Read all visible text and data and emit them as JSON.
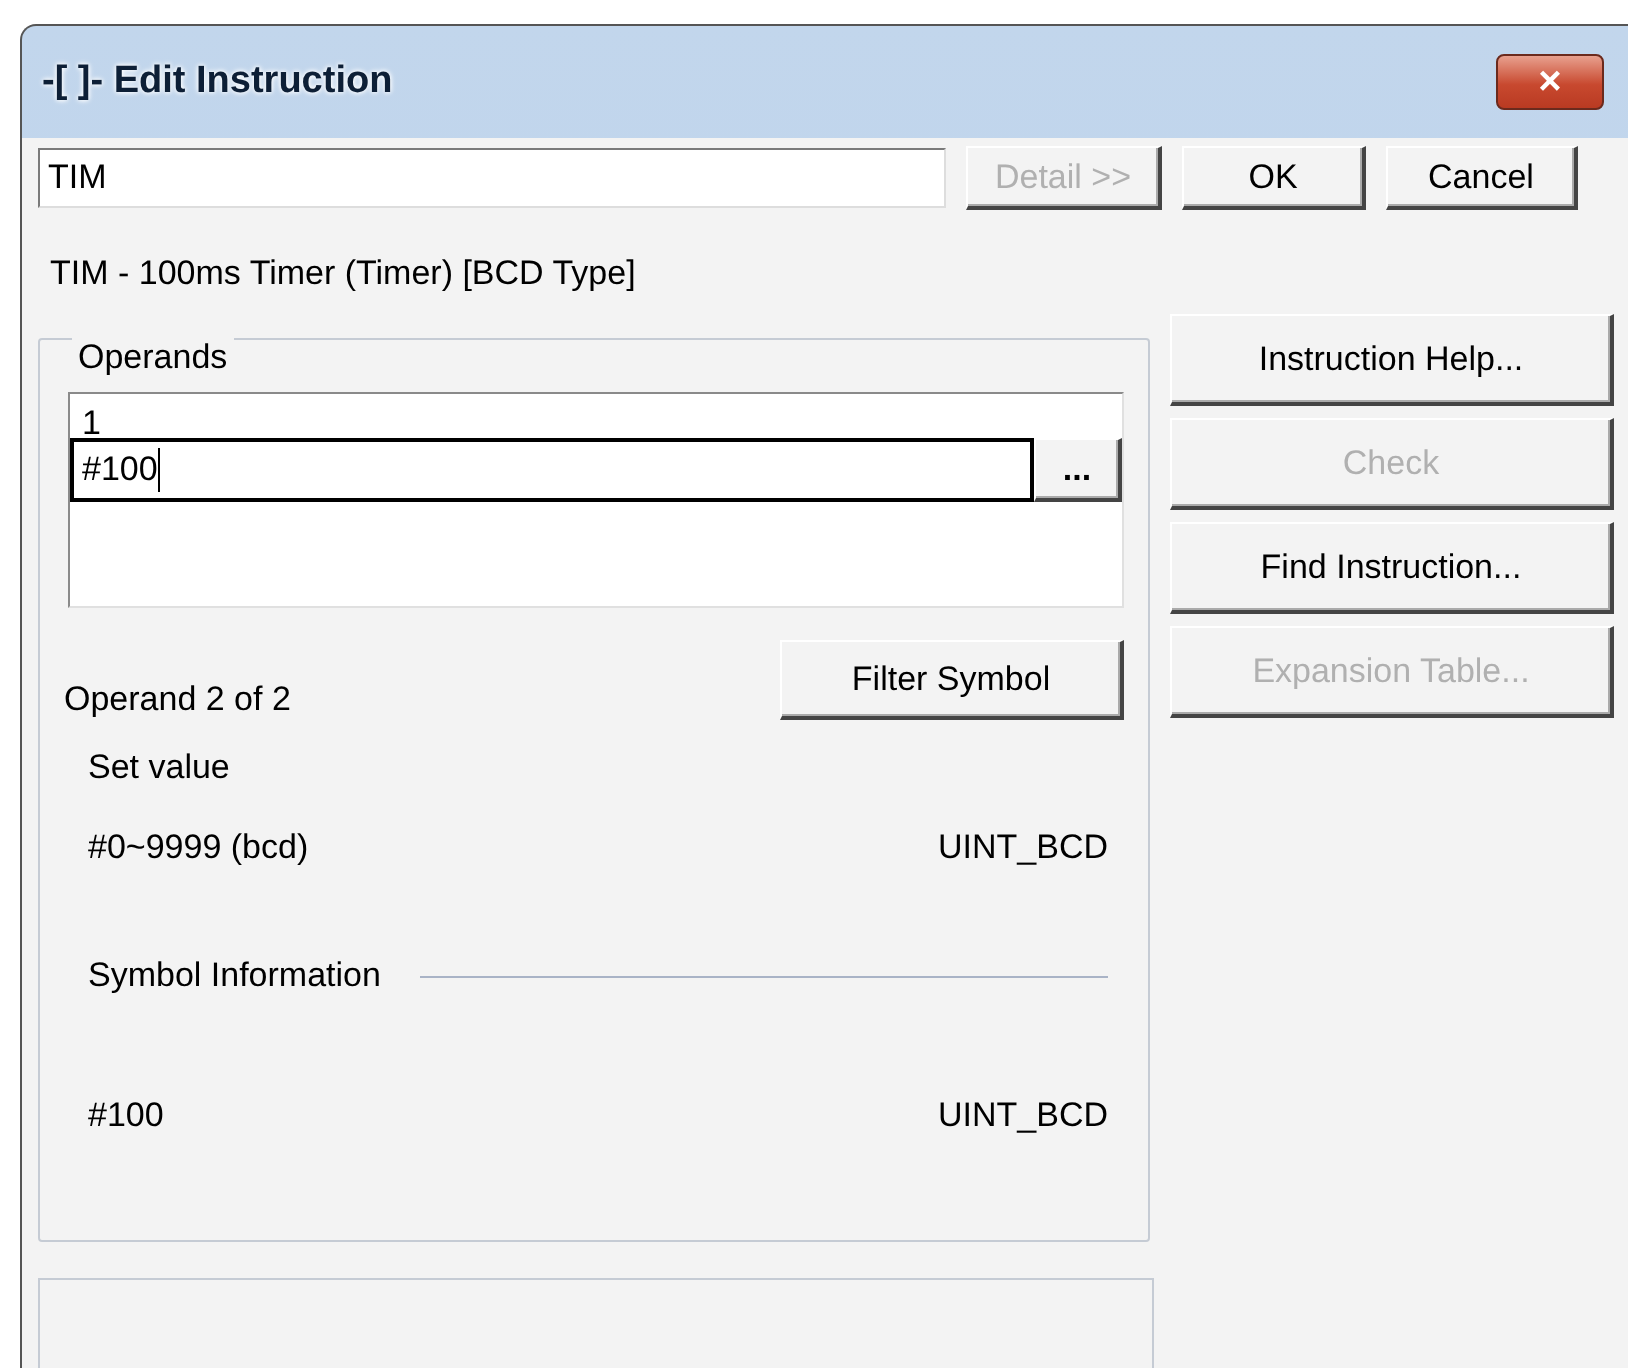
{
  "window": {
    "title": "-[ ]- Edit Instruction",
    "close": "×"
  },
  "instruction_field": {
    "value": "TIM"
  },
  "top_buttons": [
    {
      "label": "Detail >>",
      "disabled": true
    },
    {
      "label": "OK",
      "disabled": false
    },
    {
      "label": "Cancel",
      "disabled": false
    }
  ],
  "description": "TIM - 100ms Timer (Timer) [BCD Type]",
  "operands": {
    "title": "Operands",
    "rows": [
      {
        "value": "1",
        "kind": "text"
      },
      {
        "value": "#100",
        "kind": "editing",
        "browse": "..."
      }
    ],
    "position": "Operand 2 of 2",
    "filter_button": "Filter Symbol",
    "set_value_label": "Set value",
    "set_value_range": "#0~9999 (bcd)",
    "set_value_type": "UINT_BCD",
    "symbol_info_label": "Symbol Information",
    "symbol_value": "#100",
    "symbol_type": "UINT_BCD"
  },
  "side_buttons": [
    {
      "label": "Instruction Help...",
      "disabled": false
    },
    {
      "label": "Check",
      "disabled": true
    },
    {
      "label": "Find Instruction...",
      "disabled": false
    },
    {
      "label": "Expansion Table...",
      "disabled": true
    }
  ]
}
